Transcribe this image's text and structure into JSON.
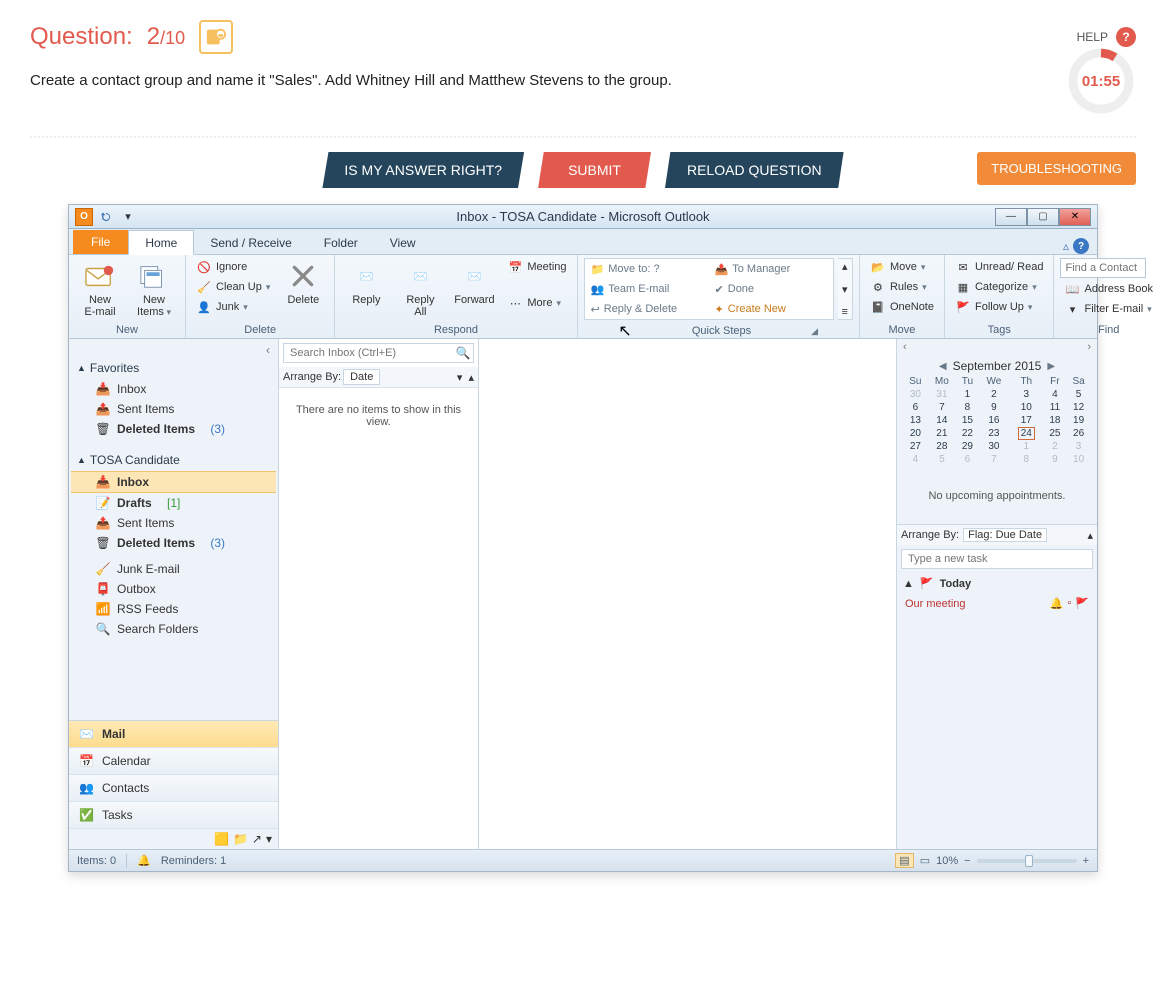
{
  "question": {
    "label": "Question:",
    "current": "2",
    "total": "/10",
    "help": "HELP",
    "timer": "01:55",
    "instruction": "Create a contact group and name it \"Sales\". Add Whitney Hill and Matthew Stevens to the group."
  },
  "buttons": {
    "check": "IS MY ANSWER RIGHT?",
    "submit": "SUBMIT",
    "reload": "RELOAD QUESTION",
    "trouble": "TROUBLESHOOTING"
  },
  "ol": {
    "title": "Inbox - TOSA Candidate - Microsoft Outlook",
    "tabs": {
      "file": "File",
      "home": "Home",
      "sendrecv": "Send / Receive",
      "folder": "Folder",
      "view": "View"
    },
    "ribbon": {
      "group_new": "New",
      "new_email": "New\nE-mail",
      "new_items": "New\nItems",
      "group_delete": "Delete",
      "ignore": "Ignore",
      "cleanup": "Clean Up",
      "junk": "Junk",
      "delete": "Delete",
      "group_respond": "Respond",
      "reply": "Reply",
      "reply_all": "Reply\nAll",
      "forward": "Forward",
      "meeting": "Meeting",
      "more": "More",
      "group_qs": "Quick Steps",
      "qs_moveto": "Move to: ?",
      "qs_tomgr": "To Manager",
      "qs_team": "Team E-mail",
      "qs_done": "Done",
      "qs_repdel": "Reply & Delete",
      "qs_create": "Create New",
      "group_move": "Move",
      "move": "Move",
      "rules": "Rules",
      "onenote": "OneNote",
      "group_tags": "Tags",
      "unread": "Unread/ Read",
      "categorize": "Categorize",
      "followup": "Follow Up",
      "group_find": "Find",
      "find_contact_ph": "Find a Contact",
      "addressbook": "Address Book",
      "filter": "Filter E-mail"
    },
    "nav": {
      "favorites": "Favorites",
      "inbox": "Inbox",
      "sent": "Sent Items",
      "deleted": "Deleted Items",
      "deleted_count": "(3)",
      "account": "TOSA Candidate",
      "drafts": "Drafts",
      "drafts_count": "[1]",
      "junk": "Junk E-mail",
      "outbox": "Outbox",
      "rss": "RSS Feeds",
      "searchf": "Search Folders",
      "mail": "Mail",
      "calendar": "Calendar",
      "contacts": "Contacts",
      "tasks": "Tasks"
    },
    "list": {
      "search_ph": "Search Inbox (Ctrl+E)",
      "arrange": "Arrange By:",
      "arrange_val": "Date",
      "empty": "There are no items to show in this view."
    },
    "todo": {
      "month": "September 2015",
      "days": [
        "Su",
        "Mo",
        "Tu",
        "We",
        "Th",
        "Fr",
        "Sa"
      ],
      "weeks": [
        [
          {
            "d": "30",
            "g": true
          },
          {
            "d": "31",
            "g": true
          },
          {
            "d": "1"
          },
          {
            "d": "2"
          },
          {
            "d": "3"
          },
          {
            "d": "4"
          },
          {
            "d": "5"
          }
        ],
        [
          {
            "d": "6"
          },
          {
            "d": "7"
          },
          {
            "d": "8"
          },
          {
            "d": "9"
          },
          {
            "d": "10"
          },
          {
            "d": "11"
          },
          {
            "d": "12"
          }
        ],
        [
          {
            "d": "13"
          },
          {
            "d": "14"
          },
          {
            "d": "15"
          },
          {
            "d": "16"
          },
          {
            "d": "17"
          },
          {
            "d": "18"
          },
          {
            "d": "19"
          }
        ],
        [
          {
            "d": "20"
          },
          {
            "d": "21"
          },
          {
            "d": "22"
          },
          {
            "d": "23"
          },
          {
            "d": "24",
            "t": true
          },
          {
            "d": "25"
          },
          {
            "d": "26"
          }
        ],
        [
          {
            "d": "27"
          },
          {
            "d": "28"
          },
          {
            "d": "29"
          },
          {
            "d": "30"
          },
          {
            "d": "1",
            "g": true
          },
          {
            "d": "2",
            "g": true
          },
          {
            "d": "3",
            "g": true
          }
        ],
        [
          {
            "d": "4",
            "g": true
          },
          {
            "d": "5",
            "g": true
          },
          {
            "d": "6",
            "g": true
          },
          {
            "d": "7",
            "g": true
          },
          {
            "d": "8",
            "g": true
          },
          {
            "d": "9",
            "g": true
          },
          {
            "d": "10",
            "g": true
          }
        ]
      ],
      "noappt": "No upcoming appointments.",
      "arrange": "Arrange By:",
      "arrange_val": "Flag: Due Date",
      "newtask_ph": "Type a new task",
      "today": "Today",
      "task1": "Our meeting"
    },
    "status": {
      "items": "Items: 0",
      "reminders": "Reminders: 1",
      "zoom": "10%"
    }
  }
}
